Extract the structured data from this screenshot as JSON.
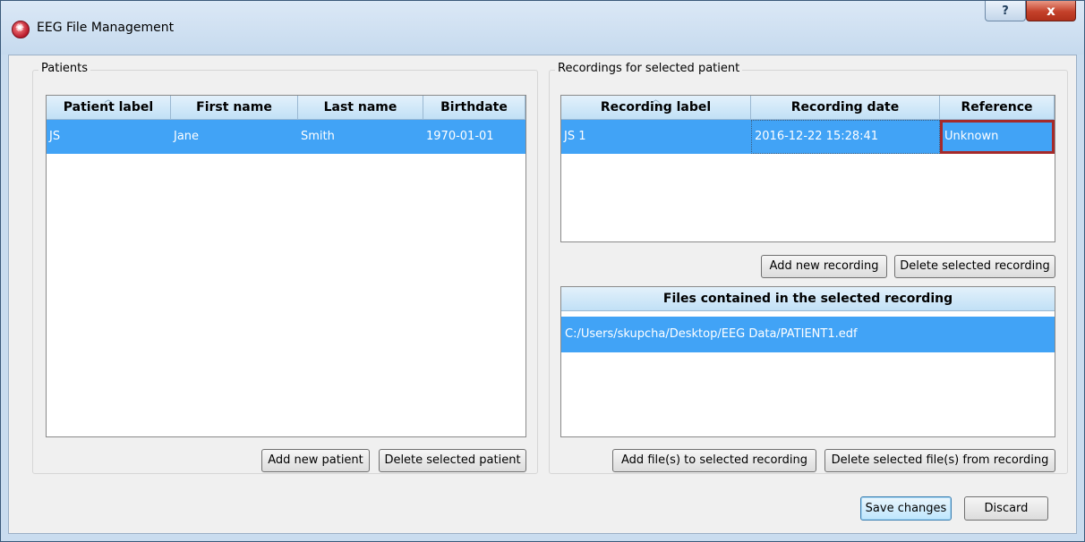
{
  "window": {
    "title": "EEG File Management",
    "help_label": "?",
    "close_label": "x"
  },
  "patients": {
    "group_title": "Patients",
    "columns": [
      "Patient label",
      "First name",
      "Last name",
      "Birthdate"
    ],
    "rows": [
      {
        "label": "JS",
        "first_name": "Jane",
        "last_name": "Smith",
        "birthdate": "1970-01-01"
      }
    ],
    "add_button": "Add new patient",
    "delete_button": "Delete selected patient"
  },
  "recordings": {
    "group_title": "Recordings for selected patient",
    "columns": [
      "Recording label",
      "Recording date",
      "Reference"
    ],
    "rows": [
      {
        "label": "JS 1",
        "date": "2016-12-22 15:28:41",
        "reference": "Unknown"
      }
    ],
    "add_button": "Add new recording",
    "delete_button": "Delete selected recording"
  },
  "files": {
    "header": "Files contained in the selected recording",
    "rows": [
      "C:/Users/skupcha/Desktop/EEG Data/PATIENT1.edf"
    ],
    "add_button": "Add file(s) to selected recording",
    "delete_button": "Delete selected file(s) from recording"
  },
  "footer": {
    "save_button": "Save changes",
    "discard_button": "Discard"
  },
  "colors": {
    "selection": "#41a3f6",
    "header_gradient_top": "#e3f1fb",
    "header_gradient_bottom": "#c1e0f6",
    "close_button": "#c4412a",
    "focus_outline": "#a52a2a"
  },
  "icons": {
    "app": "eeg-app-icon",
    "help": "help-icon",
    "close": "close-icon",
    "sort": "sort-ascending-icon"
  }
}
